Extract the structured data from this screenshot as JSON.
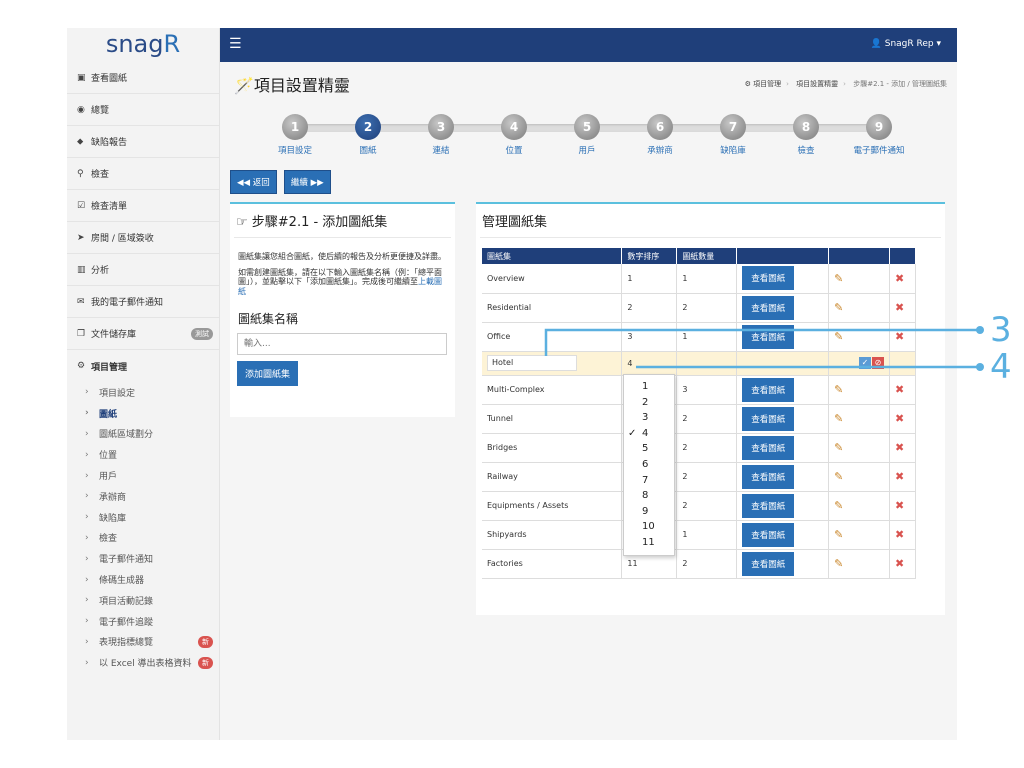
{
  "brand": {
    "logo_main": "snag",
    "logo_r": "R"
  },
  "topbar": {
    "menu_icon": "hamburger-icon",
    "user": "SnagR Rep"
  },
  "sidebar": {
    "items": [
      {
        "icon": "image-icon",
        "glyph": "▣",
        "label": "查看圖紙"
      },
      {
        "icon": "dashboard-icon",
        "glyph": "◉",
        "label": "總覽"
      },
      {
        "icon": "map-marker-icon",
        "glyph": "⬥",
        "label": "缺陷報告"
      },
      {
        "icon": "search-icon",
        "glyph": "⚲",
        "label": "檢查"
      },
      {
        "icon": "checklist-icon",
        "glyph": "☑",
        "label": "檢查清單"
      },
      {
        "icon": "location-arrow-icon",
        "glyph": "➤",
        "label": "房間 / 區域簽收"
      },
      {
        "icon": "bar-chart-icon",
        "glyph": "▥",
        "label": "分析"
      },
      {
        "icon": "envelope-icon",
        "glyph": "✉",
        "label": "我的電子郵件通知"
      },
      {
        "icon": "files-icon",
        "glyph": "❐",
        "label": "文件儲存庫",
        "badge": "測試"
      },
      {
        "icon": "cogs-icon",
        "glyph": "⚙",
        "label": "項目管理"
      }
    ],
    "sub_items": [
      {
        "label": "項目設定"
      },
      {
        "label": "圖紙",
        "active": true
      },
      {
        "label": "圖紙區域劃分"
      },
      {
        "label": "位置"
      },
      {
        "label": "用戶"
      },
      {
        "label": "承辦商"
      },
      {
        "label": "缺陷庫"
      },
      {
        "label": "檢查"
      },
      {
        "label": "電子郵件通知"
      },
      {
        "label": "條碼生成器"
      },
      {
        "label": "項目活動記錄"
      },
      {
        "label": "電子郵件追蹤"
      },
      {
        "label": "表現指標總覽",
        "badge": "新"
      },
      {
        "label": "以 Excel 導出表格資料",
        "badge": "新"
      }
    ]
  },
  "header": {
    "title": "項目設置精靈",
    "wand_icon": "magic-wand-icon"
  },
  "breadcrumb": {
    "items": [
      "項目管理",
      "項目設置精靈",
      "步驟#2.1 - 添加 / 管理圖紙集"
    ]
  },
  "steps": [
    {
      "num": "1",
      "label": "項目設定"
    },
    {
      "num": "2",
      "label": "圖紙",
      "active": true
    },
    {
      "num": "3",
      "label": "連結"
    },
    {
      "num": "4",
      "label": "位置"
    },
    {
      "num": "5",
      "label": "用戶"
    },
    {
      "num": "6",
      "label": "承辦商"
    },
    {
      "num": "7",
      "label": "缺陷庫"
    },
    {
      "num": "8",
      "label": "檢查"
    },
    {
      "num": "9",
      "label": "電子郵件通知"
    }
  ],
  "nav_buttons": {
    "back": "◀◀ 返回",
    "next": "繼續 ▶▶"
  },
  "left_panel": {
    "title": "☞ 步驟#2.1 - 添加圖紙集",
    "para1": "圖紙集讓您組合圖紙，使后續的報告及分析更便捷及詳盡。",
    "para2": "如需創建圖紙集，請在以下輸入圖紙集名稱（例：「總平面圖」），並點擊以下「添加圖紙集」。完成後可繼續至",
    "para2_link": "上載圖紙",
    "field_label": "圖紙集名稱",
    "input_placeholder": "輸入...",
    "add_button": "添加圖紙集"
  },
  "right_panel": {
    "title": "管理圖紙集",
    "columns": [
      "圖紙集",
      "數字排序",
      "圖紙數量",
      "",
      "",
      ""
    ],
    "view_label": "查看圖紙",
    "rows": [
      {
        "name": "Overview",
        "order": "1",
        "count": "1"
      },
      {
        "name": "Residential",
        "order": "2",
        "count": "2"
      },
      {
        "name": "Office",
        "order": "3",
        "count": "1"
      },
      {
        "name": "Hotel",
        "order": "4",
        "count": "",
        "editing": true
      },
      {
        "name": "Multi-Complex",
        "order": "",
        "count": "3"
      },
      {
        "name": "Tunnel",
        "order": "",
        "count": "2"
      },
      {
        "name": "Bridges",
        "order": "",
        "count": "2"
      },
      {
        "name": "Railway",
        "order": "",
        "count": "2"
      },
      {
        "name": "Equipments / Assets",
        "order": "",
        "count": "2"
      },
      {
        "name": "Shipyards",
        "order": "",
        "count": "1"
      },
      {
        "name": "Factories",
        "order": "11",
        "count": "2"
      }
    ]
  },
  "dropdown": {
    "options": [
      "1",
      "2",
      "3",
      "4",
      "5",
      "6",
      "7",
      "8",
      "9",
      "10",
      "11"
    ],
    "selected": "4"
  },
  "callouts": [
    "3",
    "4"
  ],
  "colors": {
    "navy": "#1f3f7a",
    "blue": "#2a6fb5",
    "callout": "#5bb0e0",
    "danger": "#d9534f"
  }
}
